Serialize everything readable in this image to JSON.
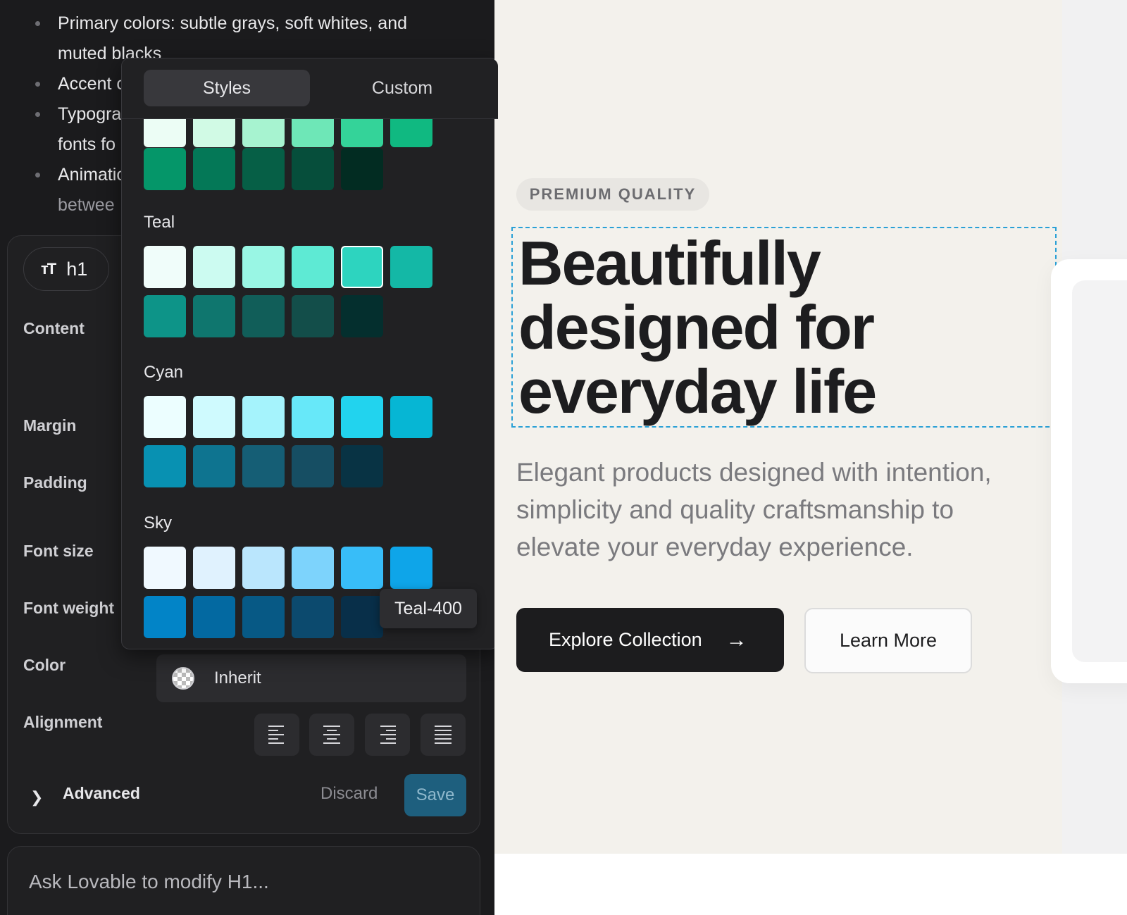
{
  "notes": {
    "bullets": [
      {
        "line1": "Primary colors: subtle grays, soft whites, and",
        "line2": "muted blacks"
      },
      {
        "line1": "Accent c",
        "line2": ""
      },
      {
        "line1": "Typogra",
        "line2": "fonts fo"
      },
      {
        "line1": "Animatio",
        "line2": "betwee"
      }
    ]
  },
  "inspector": {
    "element_tag": "h1",
    "element_icon": "text-size-icon",
    "labels": {
      "content": "Content",
      "margin": "Margin",
      "padding": "Padding",
      "font_size": "Font size",
      "font_weight": "Font weight",
      "color": "Color",
      "alignment": "Alignment"
    },
    "color_value": "Inherit",
    "alignment_options": [
      "align-left-icon",
      "align-center-icon",
      "align-right-icon",
      "align-justify-icon"
    ],
    "advanced_label": "Advanced",
    "discard_label": "Discard",
    "save_label": "Save"
  },
  "chat": {
    "placeholder": "Ask Lovable to modify H1..."
  },
  "color_picker": {
    "tabs": [
      {
        "label": "Styles",
        "active": true
      },
      {
        "label": "Custom",
        "active": false
      }
    ],
    "groups": [
      {
        "name": "",
        "colors": [
          "#ecfdf5",
          "#d1fae5",
          "#a7f3d0",
          "#6ee7b7",
          "#34d399",
          "#10b981",
          "#059669",
          "#047857",
          "#065f46",
          "#064e3b",
          "#022c22"
        ]
      },
      {
        "name": "Teal",
        "colors": [
          "#f0fdfa",
          "#ccfbf1",
          "#99f6e4",
          "#5eead4",
          "#2dd4bf",
          "#14b8a6",
          "#0d9488",
          "#0f766e",
          "#115e59",
          "#134e4a",
          "#042f2e"
        ]
      },
      {
        "name": "Cyan",
        "colors": [
          "#ecfeff",
          "#cffafe",
          "#a5f3fc",
          "#67e8f9",
          "#22d3ee",
          "#06b6d4",
          "#0891b2",
          "#0e7490",
          "#155e75",
          "#164e63",
          "#083344"
        ]
      },
      {
        "name": "Sky",
        "colors": [
          "#f0f9ff",
          "#e0f2fe",
          "#bae6fd",
          "#7dd3fc",
          "#38bdf8",
          "#0ea5e9",
          "#0284c7",
          "#0369a1",
          "#075985",
          "#0c4a6e",
          "#082f49"
        ]
      }
    ],
    "selected_swatch": "Teal 400",
    "tooltip": "Teal-400"
  },
  "preview": {
    "badge": "PREMIUM QUALITY",
    "headline": {
      "line1": "Beautifully",
      "line2": "designed for",
      "line3": "everyday life"
    },
    "lead": {
      "line1": "Elegant products designed with intention,",
      "line2": "simplicity and quality craftsmanship to",
      "line3": "elevate your everyday experience."
    },
    "primary_cta": "Explore Collection",
    "primary_cta_icon": "arrow-right-icon",
    "secondary_cta": "Learn More"
  }
}
